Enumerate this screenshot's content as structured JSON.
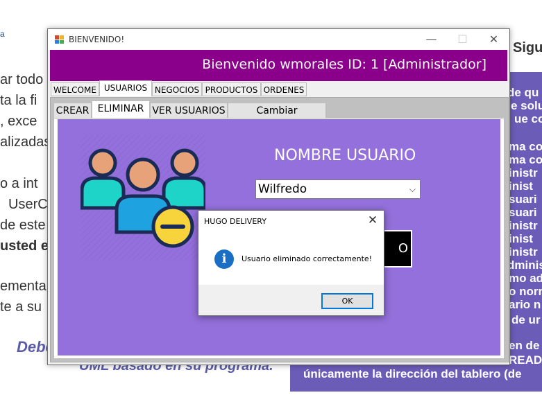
{
  "background_document": {
    "left_lines": [
      "ar todo",
      "ta la fi",
      ", exce",
      "alizadas",
      "o a int",
      "UserC",
      "de este",
      "usted es",
      "ementa",
      "te a su"
    ],
    "top_left_fragment": "a",
    "right_title": "Sigu",
    "right_lines": [
      "de qu",
      "e solu",
      "ue co",
      "ma co",
      "ma co",
      "inistr",
      "inist",
      "suari",
      "suari",
      "inistr",
      "inist",
      "inistr",
      "dminis",
      "mo ad",
      "o norr",
      "ario n",
      "de ur",
      "en de",
      "READ",
      "únicamente la dirección del tablero (de"
    ],
    "italic_lines": [
      "Debe",
      "UML basado en su programa."
    ]
  },
  "window": {
    "title": "BIENVENIDO!",
    "minimize": "—",
    "maximize": "☐",
    "close": "✕",
    "welcome": "Bienvenido wmorales  ID: 1  [Administrador]"
  },
  "main_tabs": [
    "WELCOME",
    "USUARIOS",
    "NEGOCIOS",
    "PRODUCTOS",
    "ORDENES"
  ],
  "sub_tabs": [
    "CREAR",
    "ELIMINAR",
    "VER USUARIOS",
    "Cambiar Contraseña"
  ],
  "form": {
    "label": "NOMBRE USUARIO",
    "selected_user": "Wilfredo",
    "button_fragment": "O"
  },
  "dialog": {
    "title": "HUGO DELIVERY",
    "close": "✕",
    "icon": "info-icon",
    "message": "Usuario eliminado correctamente!",
    "ok": "OK"
  },
  "colors": {
    "header": "#8b008b",
    "panel": "#9370db",
    "info": "#1a6fc4"
  }
}
